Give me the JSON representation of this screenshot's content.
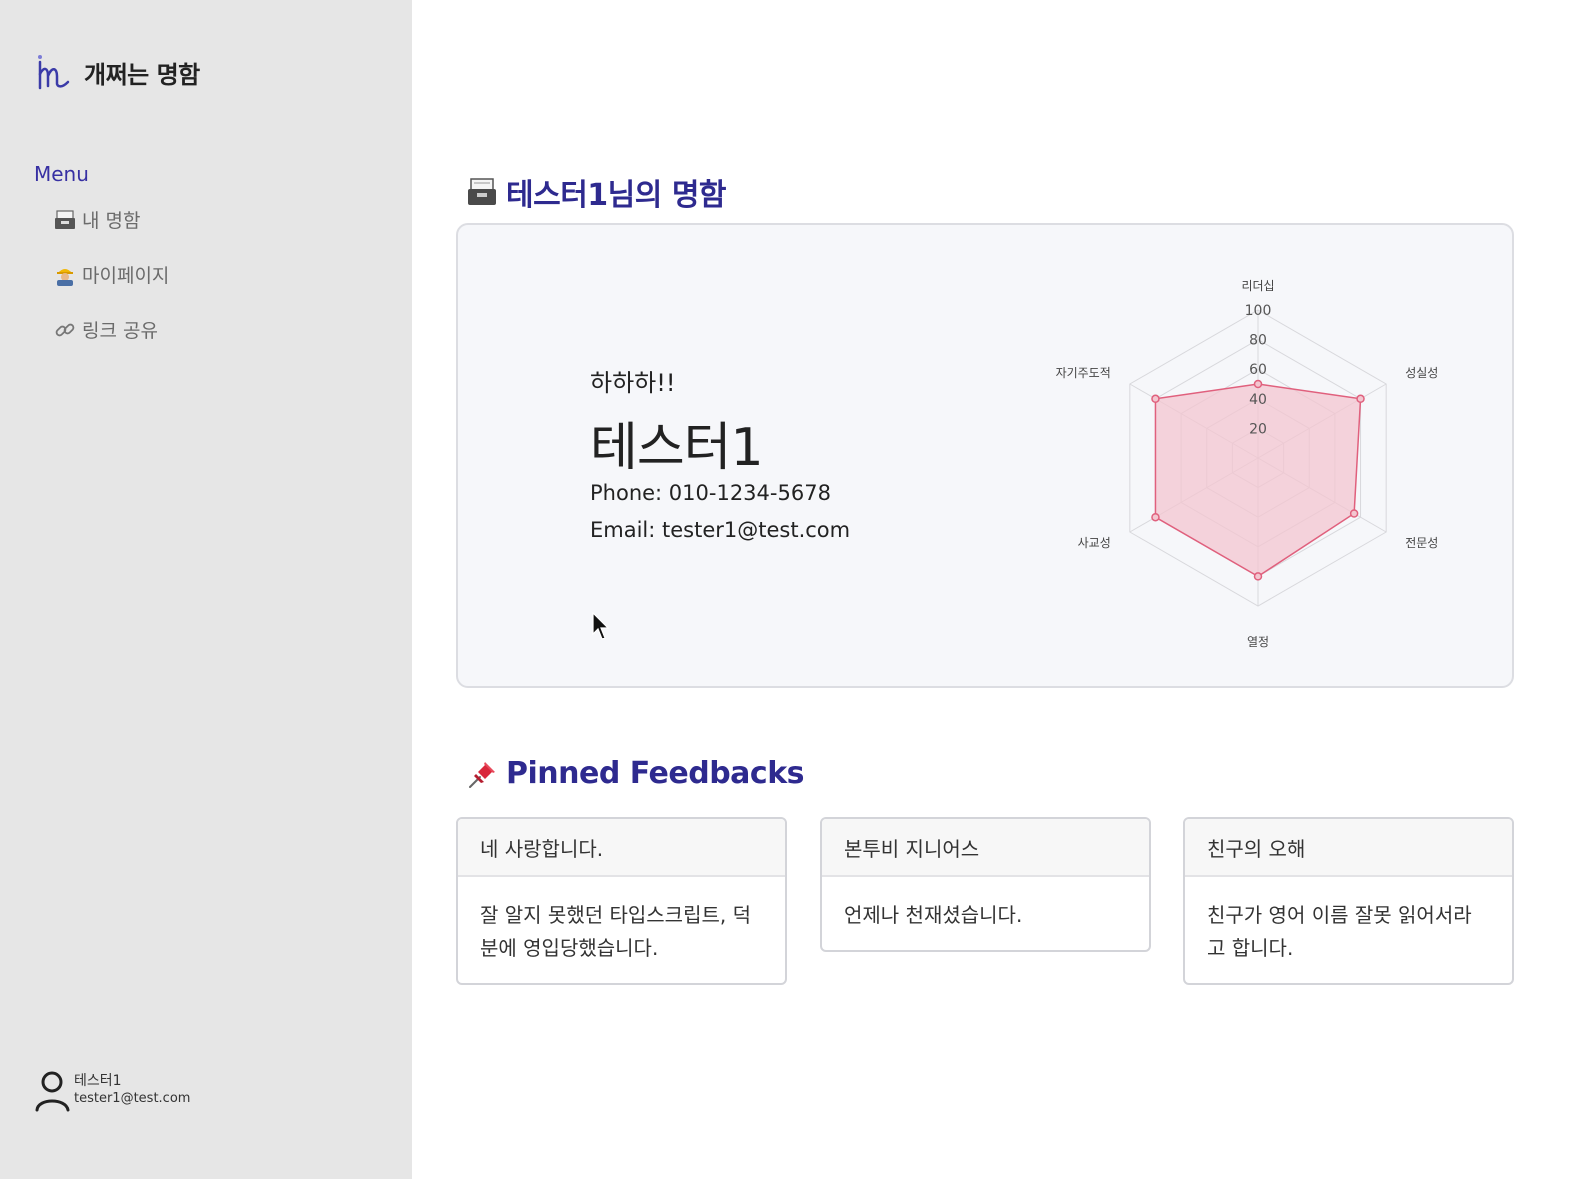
{
  "app": {
    "name": "개쩌는 명함"
  },
  "sidebar": {
    "menu_heading": "Menu",
    "items": [
      {
        "icon": "card-file-box-icon",
        "label": "내 명함"
      },
      {
        "icon": "construction-worker-icon",
        "label": "마이페이지"
      },
      {
        "icon": "link-icon",
        "label": "링크 공유"
      }
    ],
    "user": {
      "name": "테스터1",
      "email": "tester1@test.com"
    }
  },
  "main": {
    "card_title": "테스터1님의 명함",
    "card": {
      "greeting": "하하하!!",
      "name": "테스터1",
      "phone": "Phone: 010-1234-5678",
      "email": "Email: tester1@test.com"
    },
    "pinned_title": "Pinned Feedbacks",
    "feedbacks": [
      {
        "title": "네 사랑합니다.",
        "body": "잘 알지 못했던 타입스크립트, 덕분에 영입당했습니다."
      },
      {
        "title": "본투비 지니어스",
        "body": "언제나 천재셨습니다."
      },
      {
        "title": "친구의 오해",
        "body": "친구가 영어 이름 잘못 읽어서라고 합니다."
      }
    ]
  },
  "chart_data": {
    "type": "radar",
    "categories": [
      "리더십",
      "성실성",
      "전문성",
      "열정",
      "사교성",
      "자기주도적"
    ],
    "values": [
      50,
      80,
      75,
      80,
      80,
      80
    ],
    "ticks": [
      "20",
      "40",
      "60",
      "80",
      "100"
    ],
    "range": [
      0,
      100
    ],
    "colors": {
      "fill": "#f3c6d0",
      "stroke": "#e0607d",
      "grid": "#d8d8dc"
    }
  }
}
